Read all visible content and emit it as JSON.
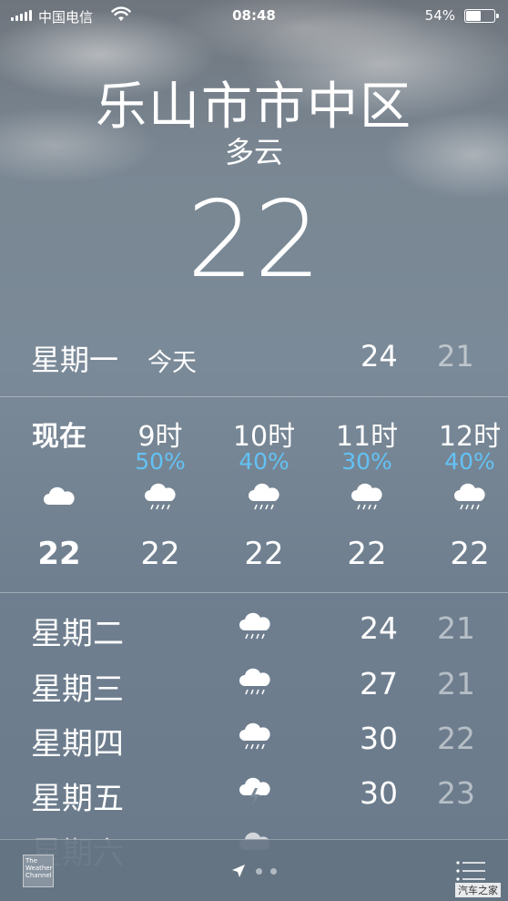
{
  "status_bar": {
    "carrier": "中国电信",
    "time": "08:48",
    "battery_percent": "54%",
    "battery_level": 0.54,
    "signal_icon": "cellular-signal-icon",
    "wifi_icon": "wifi-icon",
    "battery_icon": "battery-icon"
  },
  "header": {
    "city": "乐山市市中区",
    "condition": "多云",
    "temperature": "22"
  },
  "today": {
    "day": "星期一",
    "label": "今天",
    "high": "24",
    "low": "21"
  },
  "hourly": [
    {
      "label": "现在",
      "precip": "",
      "icon": "cloud-icon",
      "temp": "22"
    },
    {
      "label": "9时",
      "precip": "50%",
      "icon": "cloud-rain-icon",
      "temp": "22"
    },
    {
      "label": "10时",
      "precip": "40%",
      "icon": "cloud-rain-icon",
      "temp": "22"
    },
    {
      "label": "11时",
      "precip": "30%",
      "icon": "cloud-rain-icon",
      "temp": "22"
    },
    {
      "label": "12时",
      "precip": "40%",
      "icon": "cloud-rain-icon",
      "temp": "22"
    }
  ],
  "daily": [
    {
      "day": "星期二",
      "icon": "cloud-rain-icon",
      "high": "24",
      "low": "21"
    },
    {
      "day": "星期三",
      "icon": "cloud-rain-icon",
      "high": "27",
      "low": "21"
    },
    {
      "day": "星期四",
      "icon": "cloud-rain-icon",
      "high": "30",
      "low": "22"
    },
    {
      "day": "星期五",
      "icon": "thunderstorm-icon",
      "high": "30",
      "low": "23"
    },
    {
      "day": "星期六",
      "icon": "cloud-icon",
      "high": "",
      "low": ""
    }
  ],
  "bottom_bar": {
    "logo_line1": "The",
    "logo_line2": "Weather",
    "logo_line3": "Channel",
    "location_icon": "location-arrow-icon",
    "list_icon": "list-icon"
  },
  "watermark": "汽车之家",
  "colors": {
    "precip_blue": "#63c2f4",
    "low_temp": "rgba(255,255,255,0.5)"
  }
}
